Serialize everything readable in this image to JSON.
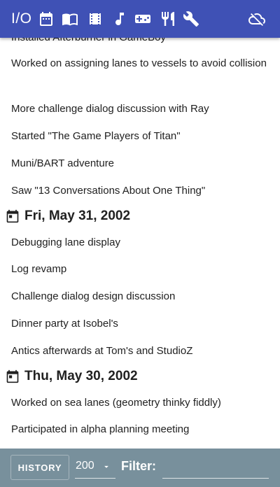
{
  "topbar": {
    "logo": "I/O",
    "icons": [
      "calendar-icon",
      "book-icon",
      "film-icon",
      "music-note-icon",
      "gamepad-icon",
      "restaurant-icon",
      "wrench-icon",
      "cloud-off-icon"
    ]
  },
  "entries_top": [
    "Installed Afterburner in GameBoy",
    "Worked on assigning lanes to vessels to avoid collision",
    "More challenge dialog discussion with Ray",
    "Started \"The Game Players of Titan\"",
    "Muni/BART adventure",
    "Saw \"13 Conversations About One Thing\""
  ],
  "days": [
    {
      "label": "Fri, May 31, 2002",
      "entries": [
        "Debugging lane display",
        "Log revamp",
        "Challenge dialog design discussion",
        "Dinner party at Isobel's",
        "Antics afterwards at Tom's and StudioZ"
      ]
    },
    {
      "label": "Thu, May 30, 2002",
      "entries": [
        "Worked on sea lanes (geometry thinky fiddly)",
        "Participated in alpha planning meeting"
      ]
    }
  ],
  "bottombar": {
    "history_label": "HISTORY",
    "count_value": "200",
    "filter_label": "Filter:",
    "filter_value": ""
  },
  "colors": {
    "topbar": "#3f51b5",
    "bottombar": "#78909c",
    "text": "#212121"
  }
}
